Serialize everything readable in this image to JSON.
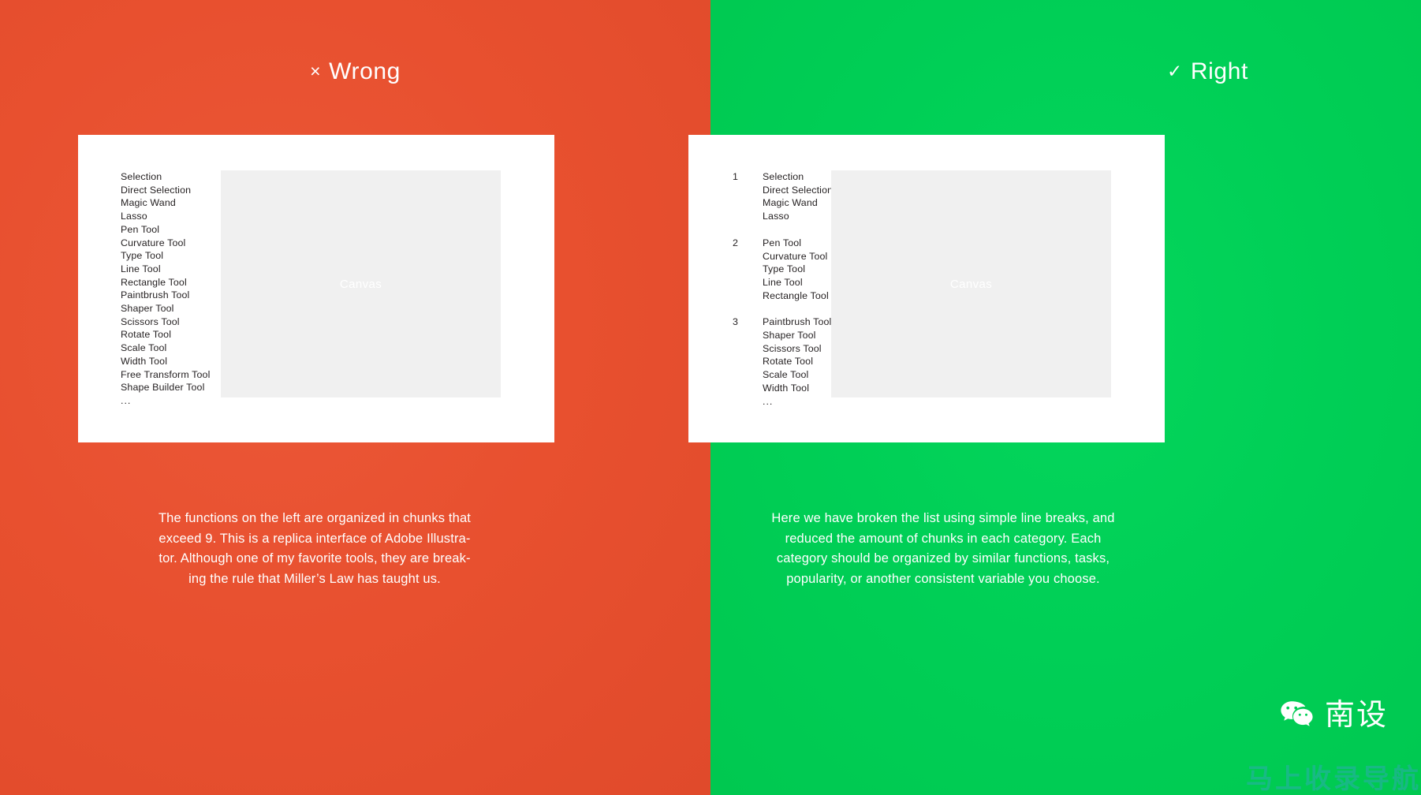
{
  "colors": {
    "wrong_bg": "#e8502f",
    "right_bg": "#00cf56",
    "card_bg": "#ffffff",
    "canvas_bg": "#f0f0f0",
    "text_dark": "#231f20",
    "text_light": "#ffffff"
  },
  "panels": {
    "wrong": {
      "mark": "×",
      "title": "Wrong",
      "canvas_label": "Canvas",
      "tools": [
        "Selection",
        "Direct Selection",
        "Magic Wand",
        "Lasso",
        "Pen Tool",
        "Curvature Tool",
        "Type Tool",
        "Line Tool",
        "Rectangle Tool",
        "Paintbrush Tool",
        "Shaper Tool",
        "Scissors Tool",
        "Rotate Tool",
        "Scale Tool",
        "Width Tool",
        "Free Transform Tool",
        "Shape Builder Tool"
      ],
      "ellipsis": "...",
      "caption_lines": [
        "The functions on the left are organized in chunks that",
        "exceed 9. This is a replica interface of Adobe Illustra-",
        "tor. Although one of my favorite tools, they are break-",
        "ing the rule that Miller’s Law has taught us."
      ]
    },
    "right": {
      "mark": "✓",
      "title": "Right",
      "canvas_label": "Canvas",
      "groups": [
        {
          "number": "1",
          "items": [
            "Selection",
            "Direct Selection",
            "Magic Wand",
            "Lasso"
          ]
        },
        {
          "number": "2",
          "items": [
            "Pen Tool",
            "Curvature Tool",
            "Type Tool",
            "Line Tool",
            "Rectangle Tool"
          ]
        },
        {
          "number": "3",
          "items": [
            "Paintbrush Tool",
            "Shaper Tool",
            "Scissors Tool",
            "Rotate Tool",
            "Scale Tool",
            "Width Tool"
          ]
        }
      ],
      "ellipsis": "...",
      "caption_lines": [
        "Here we have broken the list using simple line breaks, and",
        "reduced the amount of chunks in each category. Each",
        "category should be organized by similar functions, tasks,",
        "popularity, or another consistent variable you choose."
      ]
    }
  },
  "watermark": {
    "icon": "wechat-icon",
    "label": "南设",
    "sub_label": "马上收录导航"
  }
}
